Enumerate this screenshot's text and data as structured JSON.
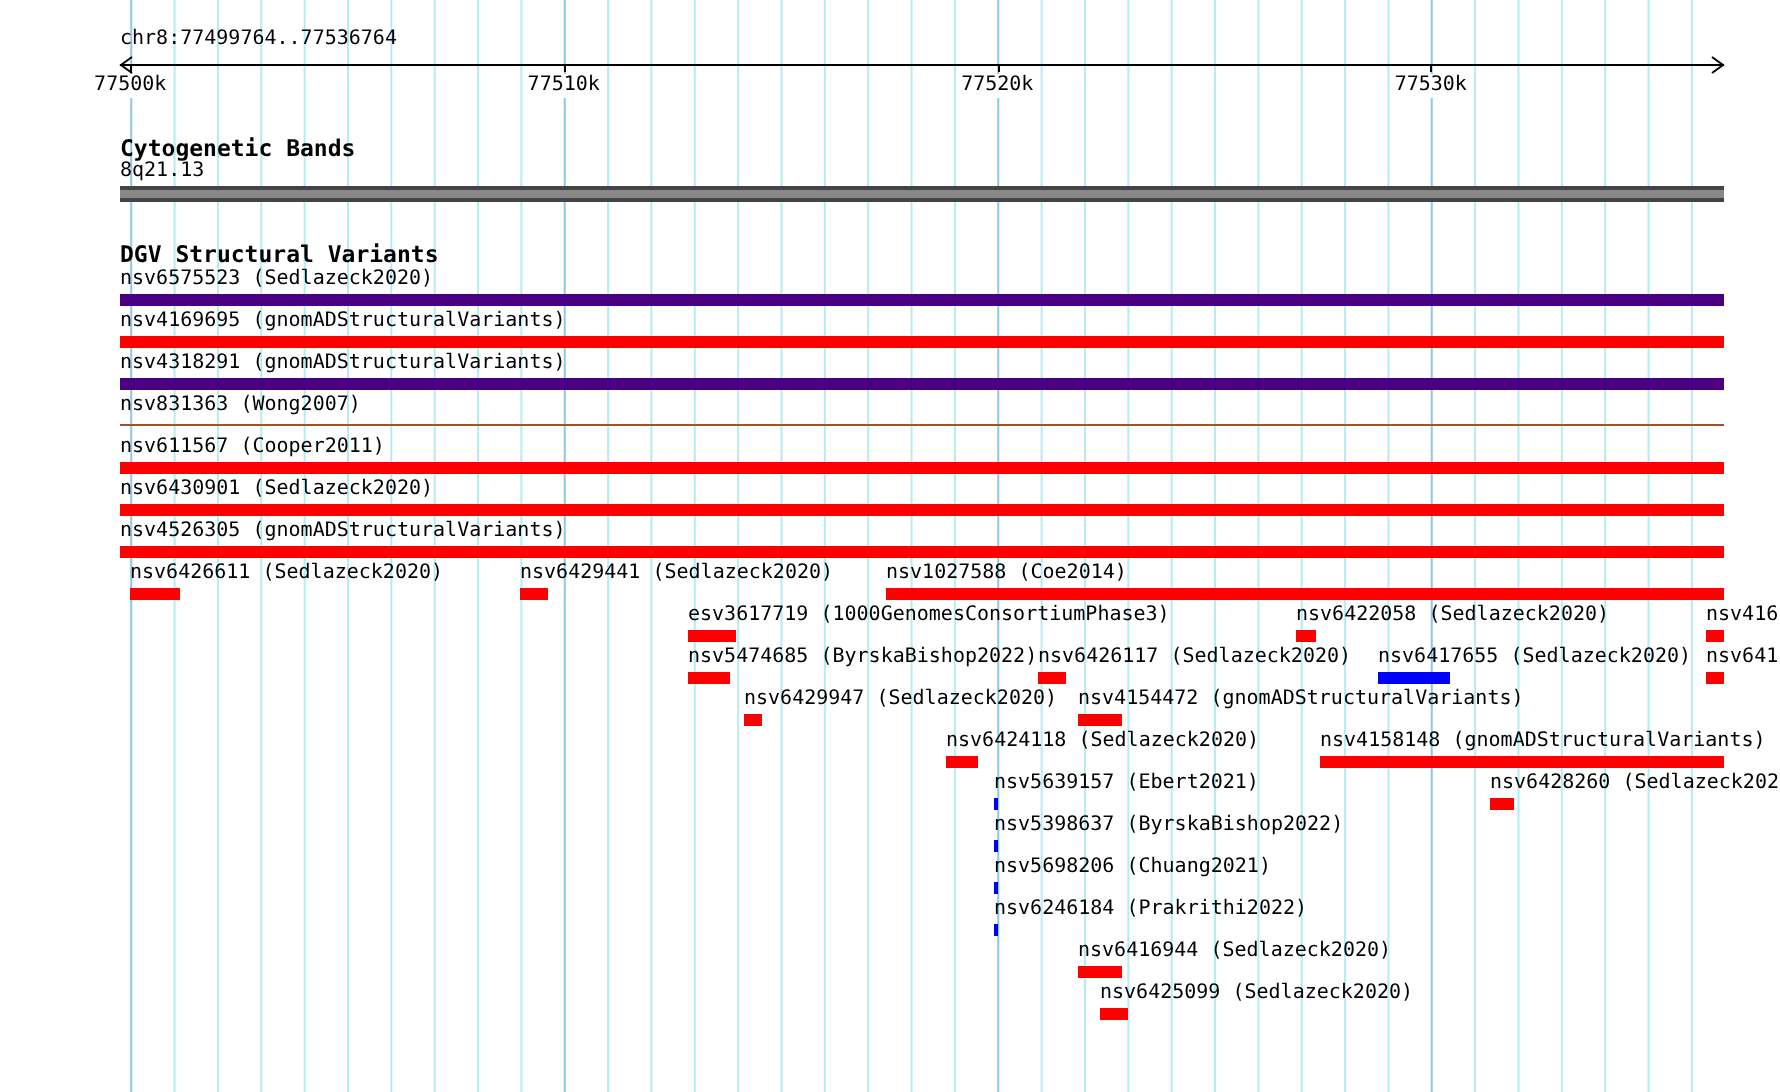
{
  "ruler": {
    "locus": "chr8:77499764..77536764",
    "ticks": [
      {
        "label": "77500k"
      },
      {
        "label": "77510k"
      },
      {
        "label": "77520k"
      },
      {
        "label": "77530k"
      }
    ]
  },
  "tracks": [
    {
      "kind": "cytoband",
      "title": "Cytogenetic Bands",
      "bands": [
        {
          "label": "8q21.13"
        }
      ]
    },
    {
      "kind": "features",
      "title": "DGV Structural Variants",
      "rows": [
        {
          "features": [
            {
              "label": "nsv6575523 (Sedlazeck2020)",
              "color": "#4b0082",
              "kind": "bar"
            }
          ]
        },
        {
          "features": [
            {
              "label": "nsv4169695 (gnomADStructuralVariants)",
              "color": "#ff0000",
              "kind": "bar"
            }
          ]
        },
        {
          "features": [
            {
              "label": "nsv4318291 (gnomADStructuralVariants)",
              "color": "#4b0082",
              "kind": "bar"
            }
          ]
        },
        {
          "features": [
            {
              "label": "nsv831363 (Wong2007)",
              "color": "#a0522d",
              "kind": "line"
            }
          ]
        },
        {
          "features": [
            {
              "label": "nsv611567 (Cooper2011)",
              "color": "#ff0000",
              "kind": "bar"
            }
          ]
        },
        {
          "features": [
            {
              "label": "nsv6430901 (Sedlazeck2020)",
              "color": "#ff0000",
              "kind": "bar"
            }
          ]
        },
        {
          "features": [
            {
              "label": "nsv4526305 (gnomADStructuralVariants)",
              "color": "#ff0000",
              "kind": "bar"
            }
          ]
        },
        {
          "features": [
            {
              "label": "nsv6426611 (Sedlazeck2020)",
              "color": "#ff0000",
              "kind": "bar"
            },
            {
              "label": "nsv6429441 (Sedlazeck2020)",
              "color": "#ff0000",
              "kind": "bar"
            },
            {
              "label": "nsv1027588 (Coe2014)",
              "color": "#ff0000",
              "kind": "bar"
            }
          ]
        },
        {
          "features": [
            {
              "label": "esv3617719 (1000GenomesConsortiumPhase3)",
              "color": "#ff0000",
              "kind": "bar"
            },
            {
              "label": "nsv6422058 (Sedlazeck2020)",
              "color": "#ff0000",
              "kind": "bar"
            },
            {
              "label": "nsv416",
              "color": "#ff0000",
              "kind": "bar"
            }
          ]
        },
        {
          "features": [
            {
              "label": "nsv5474685 (ByrskaBishop2022)",
              "color": "#ff0000",
              "kind": "bar"
            },
            {
              "label": "nsv6426117 (Sedlazeck2020)",
              "color": "#ff0000",
              "kind": "bar"
            },
            {
              "label": "nsv6417655 (Sedlazeck2020)",
              "color": "#0000ff",
              "kind": "bar"
            },
            {
              "label": "nsv641",
              "color": "#ff0000",
              "kind": "bar"
            }
          ]
        },
        {
          "features": [
            {
              "label": "nsv6429947 (Sedlazeck2020)",
              "color": "#ff0000",
              "kind": "bar"
            },
            {
              "label": "nsv4154472 (gnomADStructuralVariants)",
              "color": "#ff0000",
              "kind": "bar"
            }
          ]
        },
        {
          "features": [
            {
              "label": "nsv6424118 (Sedlazeck2020)",
              "color": "#ff0000",
              "kind": "bar"
            },
            {
              "label": "nsv4158148 (gnomADStructuralVariants)",
              "color": "#ff0000",
              "kind": "bar"
            }
          ]
        },
        {
          "features": [
            {
              "label": "nsv5639157 (Ebert2021)",
              "color": "#0000ff",
              "kind": "bar"
            },
            {
              "label": "nsv6428260 (Sedlazeck202",
              "color": "#ff0000",
              "kind": "bar"
            }
          ]
        },
        {
          "features": [
            {
              "label": "nsv5398637 (ByrskaBishop2022)",
              "color": "#0000ff",
              "kind": "bar"
            }
          ]
        },
        {
          "features": [
            {
              "label": "nsv5698206 (Chuang2021)",
              "color": "#0000ff",
              "kind": "bar"
            }
          ]
        },
        {
          "features": [
            {
              "label": "nsv6246184 (Prakrithi2022)",
              "color": "#0000ff",
              "kind": "bar"
            }
          ]
        },
        {
          "features": [
            {
              "label": "nsv6416944 (Sedlazeck2020)",
              "color": "#ff0000",
              "kind": "bar"
            }
          ]
        },
        {
          "features": [
            {
              "label": "nsv6425099 (Sedlazeck2020)",
              "color": "#ff0000",
              "kind": "bar"
            }
          ]
        }
      ]
    }
  ]
}
